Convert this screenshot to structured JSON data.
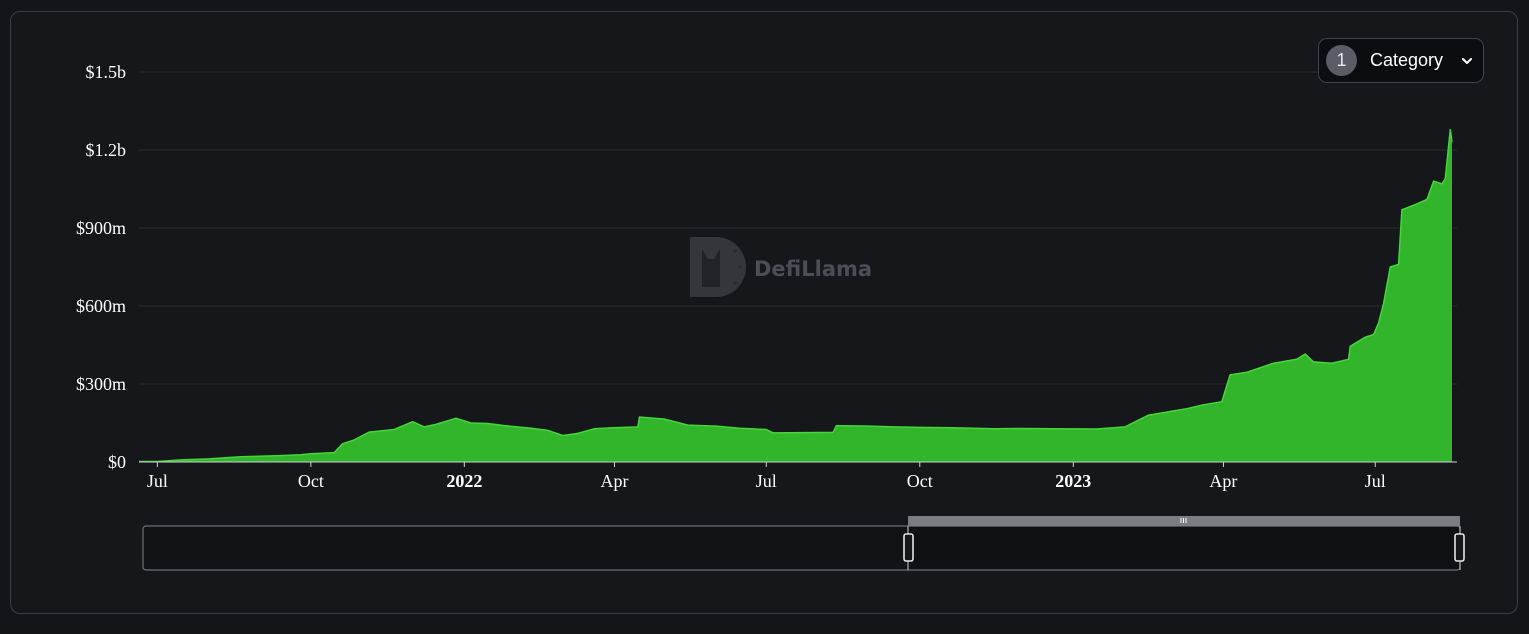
{
  "controls": {
    "category_count": "1",
    "category_label": "Category",
    "category_icon": "chevron-down-icon"
  },
  "watermark": {
    "text": "DefiLlama",
    "icon": "llama-logo-icon"
  },
  "colors": {
    "series_fill": "#33b52b",
    "series_line": "#45d63a",
    "gridline": "#2a2c31",
    "axis_text": "#ffffff",
    "background": "#16171b"
  },
  "chart_data": {
    "type": "area",
    "title": "",
    "xlabel": "",
    "ylabel": "",
    "ylim": [
      0,
      1500000000
    ],
    "xlim": [
      "2021-06-20",
      "2023-08-19"
    ],
    "grid": true,
    "legend": "none",
    "y_ticks": [
      {
        "value": 0,
        "label": "$0"
      },
      {
        "value": 300000000,
        "label": "$300m"
      },
      {
        "value": 600000000,
        "label": "$600m"
      },
      {
        "value": 900000000,
        "label": "$900m"
      },
      {
        "value": 1200000000,
        "label": "$1.2b"
      },
      {
        "value": 1500000000,
        "label": "$1.5b"
      }
    ],
    "x_ticks": [
      {
        "date": "2021-07-01",
        "label": "Jul",
        "bold": false
      },
      {
        "date": "2021-10-01",
        "label": "Oct",
        "bold": false
      },
      {
        "date": "2022-01-01",
        "label": "2022",
        "bold": true
      },
      {
        "date": "2022-04-01",
        "label": "Apr",
        "bold": false
      },
      {
        "date": "2022-07-01",
        "label": "Jul",
        "bold": false
      },
      {
        "date": "2022-10-01",
        "label": "Oct",
        "bold": false
      },
      {
        "date": "2023-01-01",
        "label": "2023",
        "bold": true
      },
      {
        "date": "2023-04-01",
        "label": "Apr",
        "bold": false
      },
      {
        "date": "2023-07-01",
        "label": "Jul",
        "bold": false
      }
    ],
    "series": [
      {
        "points": [
          [
            "2021-06-20",
            2000000
          ],
          [
            "2021-07-01",
            2000000
          ],
          [
            "2021-07-15",
            8000000
          ],
          [
            "2021-08-01",
            12000000
          ],
          [
            "2021-08-20",
            20000000
          ],
          [
            "2021-09-10",
            24000000
          ],
          [
            "2021-09-25",
            28000000
          ],
          [
            "2021-10-01",
            32000000
          ],
          [
            "2021-10-15",
            36000000
          ],
          [
            "2021-10-20",
            70000000
          ],
          [
            "2021-10-27",
            85000000
          ],
          [
            "2021-11-05",
            115000000
          ],
          [
            "2021-11-20",
            125000000
          ],
          [
            "2021-12-01",
            155000000
          ],
          [
            "2021-12-08",
            135000000
          ],
          [
            "2021-12-15",
            145000000
          ],
          [
            "2021-12-27",
            168000000
          ],
          [
            "2022-01-05",
            150000000
          ],
          [
            "2022-01-15",
            148000000
          ],
          [
            "2022-01-25",
            140000000
          ],
          [
            "2022-02-10",
            130000000
          ],
          [
            "2022-02-20",
            122000000
          ],
          [
            "2022-03-01",
            102000000
          ],
          [
            "2022-03-10",
            110000000
          ],
          [
            "2022-03-20",
            128000000
          ],
          [
            "2022-03-31",
            132000000
          ],
          [
            "2022-04-15",
            135000000
          ],
          [
            "2022-04-16",
            173000000
          ],
          [
            "2022-05-01",
            165000000
          ],
          [
            "2022-05-15",
            142000000
          ],
          [
            "2022-06-01",
            138000000
          ],
          [
            "2022-06-15",
            130000000
          ],
          [
            "2022-07-01",
            125000000
          ],
          [
            "2022-07-05",
            112000000
          ],
          [
            "2022-08-10",
            114000000
          ],
          [
            "2022-08-12",
            140000000
          ],
          [
            "2022-09-01",
            138000000
          ],
          [
            "2022-09-15",
            135000000
          ],
          [
            "2022-10-01",
            133000000
          ],
          [
            "2022-10-20",
            132000000
          ],
          [
            "2022-11-15",
            128000000
          ],
          [
            "2022-12-01",
            129000000
          ],
          [
            "2022-12-20",
            128000000
          ],
          [
            "2023-01-15",
            127000000
          ],
          [
            "2023-02-01",
            135000000
          ],
          [
            "2023-02-15",
            180000000
          ],
          [
            "2023-03-01",
            195000000
          ],
          [
            "2023-03-10",
            205000000
          ],
          [
            "2023-03-20",
            220000000
          ],
          [
            "2023-03-31",
            232000000
          ],
          [
            "2023-04-05",
            335000000
          ],
          [
            "2023-04-15",
            345000000
          ],
          [
            "2023-05-01",
            380000000
          ],
          [
            "2023-05-15",
            395000000
          ],
          [
            "2023-05-20",
            415000000
          ],
          [
            "2023-05-25",
            385000000
          ],
          [
            "2023-06-05",
            380000000
          ],
          [
            "2023-06-15",
            395000000
          ],
          [
            "2023-06-16",
            445000000
          ],
          [
            "2023-06-25",
            480000000
          ],
          [
            "2023-06-30",
            490000000
          ],
          [
            "2023-07-03",
            535000000
          ],
          [
            "2023-07-06",
            610000000
          ],
          [
            "2023-07-10",
            750000000
          ],
          [
            "2023-07-15",
            760000000
          ],
          [
            "2023-07-17",
            970000000
          ],
          [
            "2023-07-25",
            990000000
          ],
          [
            "2023-08-01",
            1010000000
          ],
          [
            "2023-08-05",
            1080000000
          ],
          [
            "2023-08-10",
            1070000000
          ],
          [
            "2023-08-12",
            1090000000
          ],
          [
            "2023-08-15",
            1280000000
          ],
          [
            "2023-08-16",
            1230000000
          ]
        ]
      }
    ],
    "brush": {
      "range_start_fraction": 0.579,
      "range_end_fraction": 1.0
    }
  }
}
